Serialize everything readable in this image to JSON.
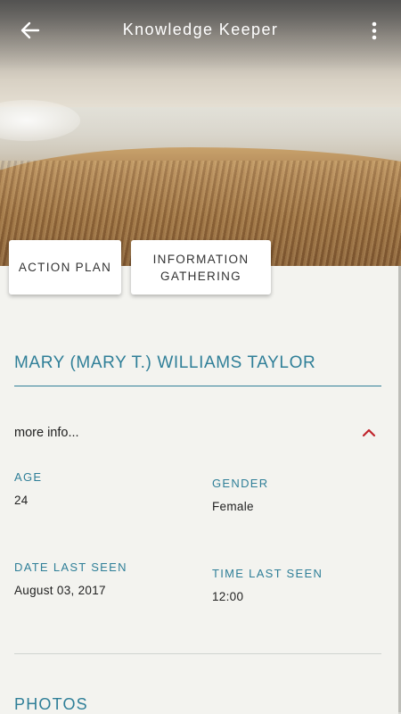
{
  "app": {
    "title": "Knowledge Keeper"
  },
  "appbar": {
    "back_icon": "arrow-left-icon",
    "menu_icon": "more-vertical-icon"
  },
  "tabs": [
    {
      "label": "ACTION PLAN"
    },
    {
      "label": "INFORMATION GATHERING",
      "line1": "INFORMATION",
      "line2": "GATHERING"
    }
  ],
  "person": {
    "name": "MARY (MARY T.) WILLIAMS TAYLOR"
  },
  "details": {
    "toggle_label": "more info...",
    "toggle_icon": "chevron-up-icon",
    "age": {
      "label": "AGE",
      "value": "24"
    },
    "gender": {
      "label": "GENDER",
      "value": "Female"
    },
    "date_last_seen": {
      "label": "DATE LAST SEEN",
      "value": "August 03, 2017"
    },
    "time_last_seen": {
      "label": "TIME LAST SEEN",
      "value": "12:00"
    }
  },
  "sections": {
    "photos_title": "PHOTOS"
  },
  "colors": {
    "accent": "#2f7f98",
    "chevron": "#c0242c",
    "background": "#f3f3ef"
  }
}
